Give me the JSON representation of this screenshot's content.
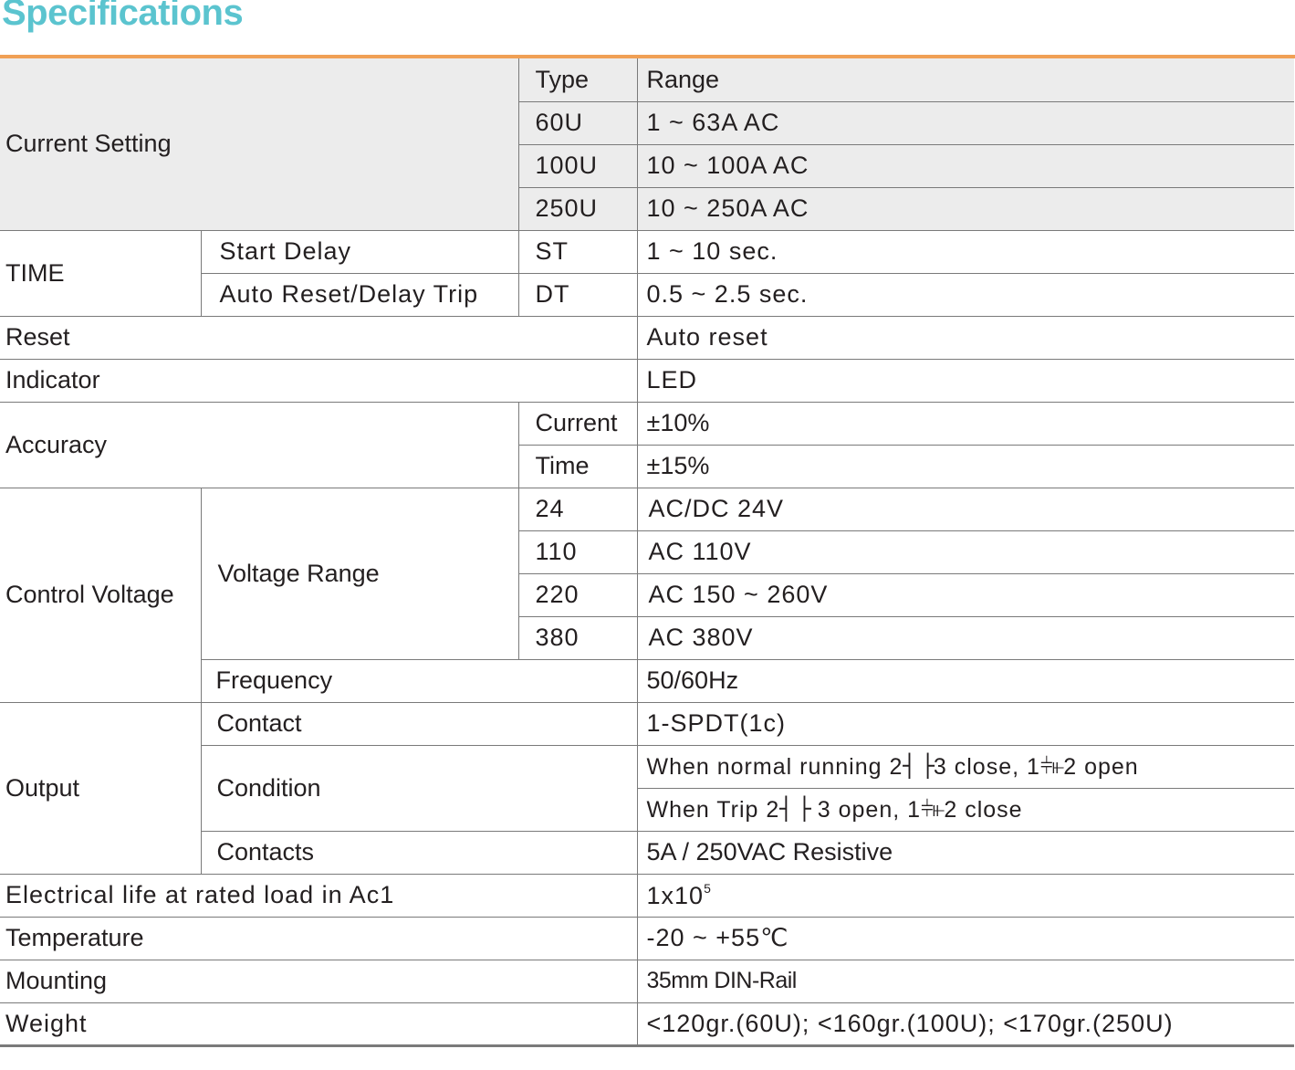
{
  "title": "Specifications",
  "current_setting": {
    "label": "Current Setting",
    "type_header": "Type",
    "range_header": "Range",
    "rows": [
      {
        "type": "60U",
        "range": "1 ~ 63A AC"
      },
      {
        "type": "100U",
        "range": "10 ~ 100A AC"
      },
      {
        "type": "250U",
        "range": "10 ~ 250A AC"
      }
    ]
  },
  "time": {
    "label": "TIME",
    "rows": [
      {
        "name": "Start Delay",
        "code": "ST",
        "value": "1 ~ 10 sec."
      },
      {
        "name": "Auto Reset/Delay Trip",
        "code": "DT",
        "value": "0.5 ~ 2.5 sec."
      }
    ]
  },
  "reset": {
    "label": "Reset",
    "value": "Auto reset"
  },
  "indicator": {
    "label": "Indicator",
    "value": "LED"
  },
  "accuracy": {
    "label": "Accuracy",
    "rows": [
      {
        "name": "Current",
        "value": "±10%"
      },
      {
        "name": "Time",
        "value": "±15%"
      }
    ]
  },
  "control_voltage": {
    "label": "Control Voltage",
    "voltage_range_label": "Voltage Range",
    "rows": [
      {
        "code": "24",
        "value": "AC/DC 24V"
      },
      {
        "code": "110",
        "value": "AC 110V"
      },
      {
        "code": "220",
        "value": "AC 150 ~ 260V"
      },
      {
        "code": "380",
        "value": "AC 380V"
      }
    ],
    "frequency_label": "Frequency",
    "frequency_value": "50/60Hz"
  },
  "output": {
    "label": "Output",
    "contact_label": "Contact",
    "contact_value": "1-SPDT(1c)",
    "condition_label": "Condition",
    "condition_normal": {
      "prefix": "When normal running  2",
      "no_symbol": "┤ ├",
      "mid": "3 close, 1",
      "nc_symbol": "⫩⫦",
      "suffix": "2 open"
    },
    "condition_trip": {
      "prefix": "When Trip 2",
      "no_symbol": "┤ ├",
      "mid": " 3 open, 1",
      "nc_symbol": "⫩⫦",
      "suffix": "2 close"
    },
    "contacts_label": "Contacts",
    "contacts_value": "5A / 250VAC Resistive"
  },
  "electrical_life": {
    "label": "Electrical life at rated load in Ac1",
    "value_base": "1x10",
    "value_exp": "5"
  },
  "temperature": {
    "label": "Temperature",
    "value": "-20 ~ +55℃"
  },
  "mounting": {
    "label": "Mounting",
    "value": "35mm DIN-Rail"
  },
  "weight": {
    "label": "Weight",
    "value": "<120gr.(60U); <160gr.(100U); <170gr.(250U)"
  }
}
